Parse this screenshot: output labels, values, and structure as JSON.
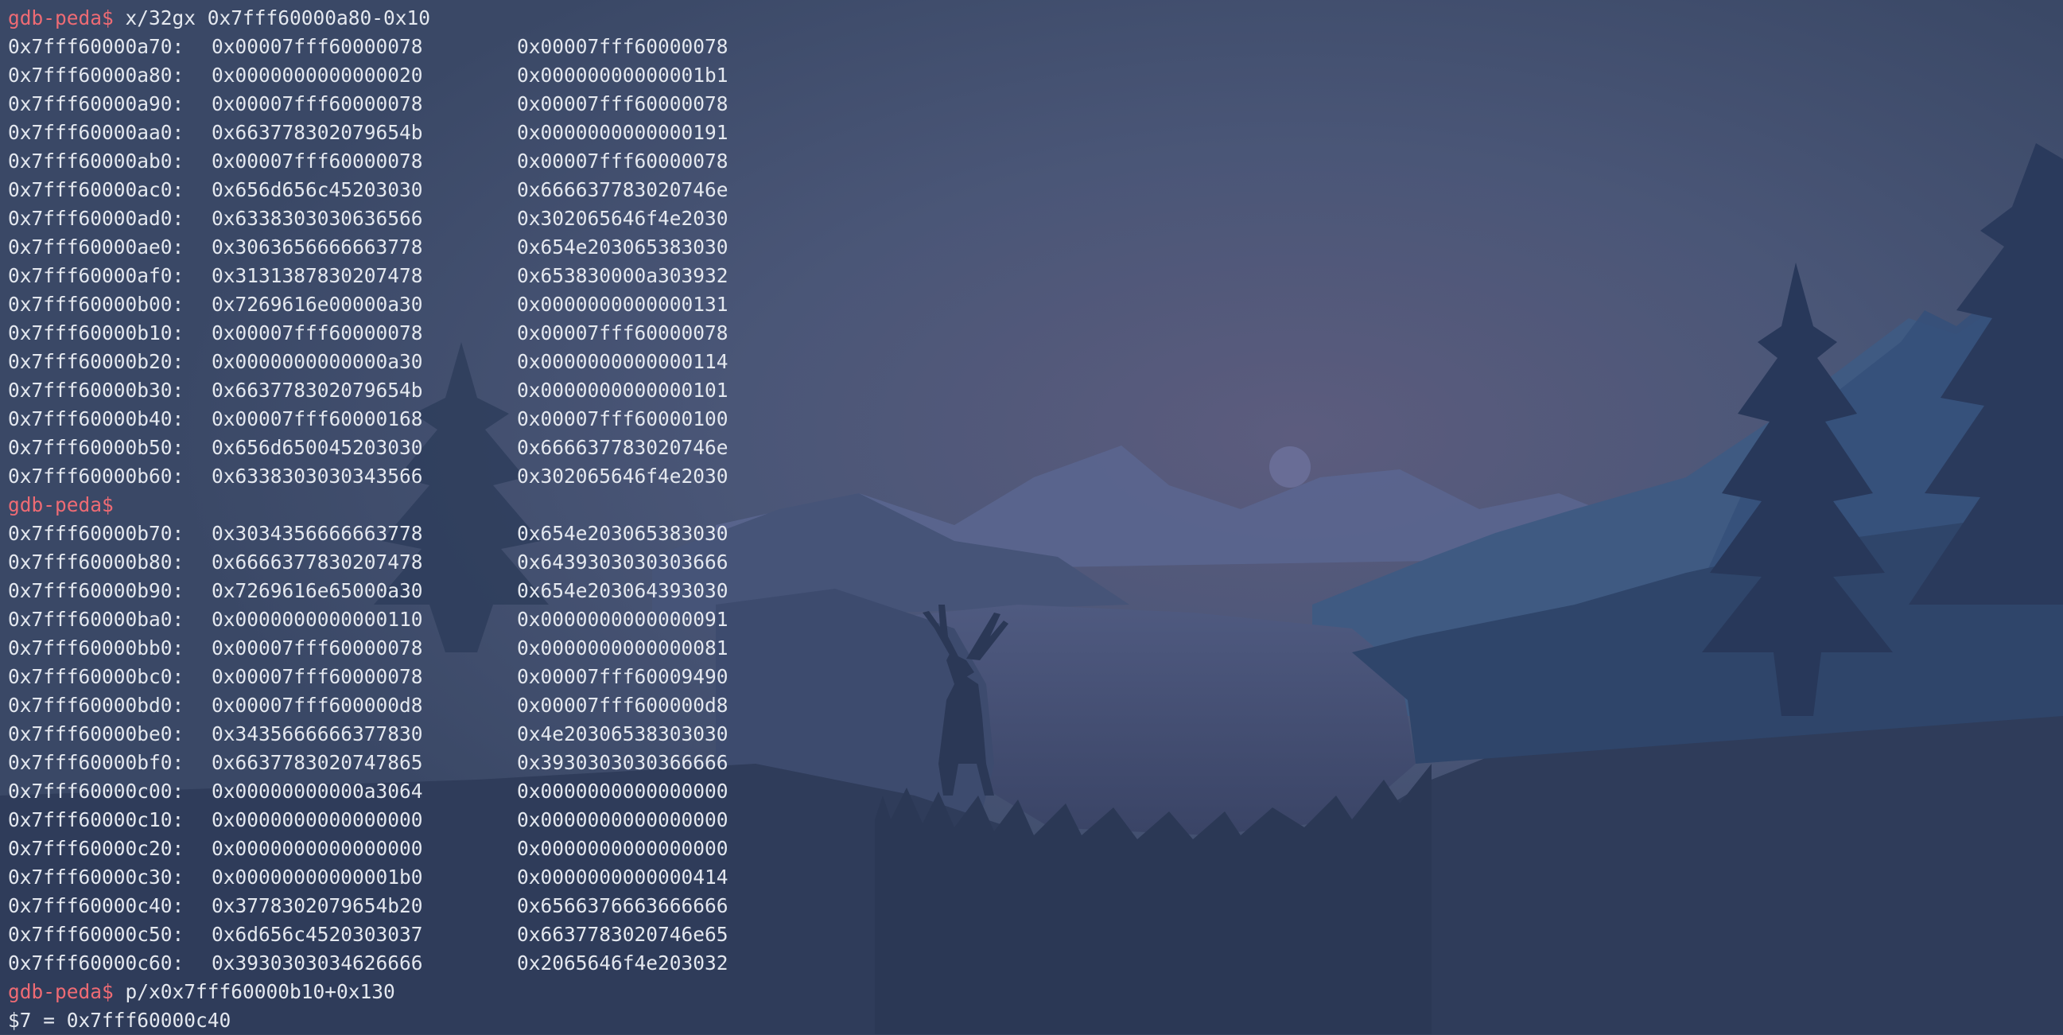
{
  "colors": {
    "prompt": "#ee6b74",
    "text": "#e4e8ef",
    "background": "#34435f",
    "sky": "#4a5a7e",
    "moon": "#6a6f99"
  },
  "prompt": "gdb-peda$",
  "blocks": [
    {
      "command": "x/32gx 0x7fff60000a80-0x10",
      "rows": [
        {
          "addr": "0x7fff60000a70:",
          "v1": "0x00007fff60000078",
          "v2": "0x00007fff60000078"
        },
        {
          "addr": "0x7fff60000a80:",
          "v1": "0x0000000000000020",
          "v2": "0x00000000000001b1"
        },
        {
          "addr": "0x7fff60000a90:",
          "v1": "0x00007fff60000078",
          "v2": "0x00007fff60000078"
        },
        {
          "addr": "0x7fff60000aa0:",
          "v1": "0x663778302079654b",
          "v2": "0x0000000000000191"
        },
        {
          "addr": "0x7fff60000ab0:",
          "v1": "0x00007fff60000078",
          "v2": "0x00007fff60000078"
        },
        {
          "addr": "0x7fff60000ac0:",
          "v1": "0x656d656c45203030",
          "v2": "0x666637783020746e"
        },
        {
          "addr": "0x7fff60000ad0:",
          "v1": "0x6338303030636566",
          "v2": "0x302065646f4e2030"
        },
        {
          "addr": "0x7fff60000ae0:",
          "v1": "0x3063656666663778",
          "v2": "0x654e203065383030"
        },
        {
          "addr": "0x7fff60000af0:",
          "v1": "0x3131387830207478",
          "v2": "0x653830000a303932"
        },
        {
          "addr": "0x7fff60000b00:",
          "v1": "0x7269616e00000a30",
          "v2": "0x0000000000000131"
        },
        {
          "addr": "0x7fff60000b10:",
          "v1": "0x00007fff60000078",
          "v2": "0x00007fff60000078"
        },
        {
          "addr": "0x7fff60000b20:",
          "v1": "0x0000000000000a30",
          "v2": "0x0000000000000114"
        },
        {
          "addr": "0x7fff60000b30:",
          "v1": "0x663778302079654b",
          "v2": "0x0000000000000101"
        },
        {
          "addr": "0x7fff60000b40:",
          "v1": "0x00007fff60000168",
          "v2": "0x00007fff60000100"
        },
        {
          "addr": "0x7fff60000b50:",
          "v1": "0x656d650045203030",
          "v2": "0x666637783020746e"
        },
        {
          "addr": "0x7fff60000b60:",
          "v1": "0x6338303030343566",
          "v2": "0x302065646f4e2030"
        }
      ]
    },
    {
      "command": "",
      "rows": [
        {
          "addr": "0x7fff60000b70:",
          "v1": "0x3034356666663778",
          "v2": "0x654e203065383030"
        },
        {
          "addr": "0x7fff60000b80:",
          "v1": "0x6666377830207478",
          "v2": "0x6439303030303666"
        },
        {
          "addr": "0x7fff60000b90:",
          "v1": "0x7269616e65000a30",
          "v2": "0x654e203064393030"
        },
        {
          "addr": "0x7fff60000ba0:",
          "v1": "0x0000000000000110",
          "v2": "0x0000000000000091"
        },
        {
          "addr": "0x7fff60000bb0:",
          "v1": "0x00007fff60000078",
          "v2": "0x0000000000000081"
        },
        {
          "addr": "0x7fff60000bc0:",
          "v1": "0x00007fff60000078",
          "v2": "0x00007fff60009490"
        },
        {
          "addr": "0x7fff60000bd0:",
          "v1": "0x00007fff600000d8",
          "v2": "0x00007fff600000d8"
        },
        {
          "addr": "0x7fff60000be0:",
          "v1": "0x3435666666377830",
          "v2": "0x4e20306538303030"
        },
        {
          "addr": "0x7fff60000bf0:",
          "v1": "0x6637783020747865",
          "v2": "0x3930303030366666"
        },
        {
          "addr": "0x7fff60000c00:",
          "v1": "0x00000000000a3064",
          "v2": "0x0000000000000000"
        },
        {
          "addr": "0x7fff60000c10:",
          "v1": "0x0000000000000000",
          "v2": "0x0000000000000000"
        },
        {
          "addr": "0x7fff60000c20:",
          "v1": "0x0000000000000000",
          "v2": "0x0000000000000000"
        },
        {
          "addr": "0x7fff60000c30:",
          "v1": "0x00000000000001b0",
          "v2": "0x0000000000000414"
        },
        {
          "addr": "0x7fff60000c40:",
          "v1": "0x3778302079654b20",
          "v2": "0x6566376663666666"
        },
        {
          "addr": "0x7fff60000c50:",
          "v1": "0x6d656c4520303037",
          "v2": "0x6637783020746e65"
        },
        {
          "addr": "0x7fff60000c60:",
          "v1": "0x3930303034626666",
          "v2": "0x2065646f4e203032"
        }
      ]
    },
    {
      "command": "p/x0x7fff60000b10+0x130",
      "rows": []
    }
  ],
  "result": "$7 = 0x7fff60000c40"
}
